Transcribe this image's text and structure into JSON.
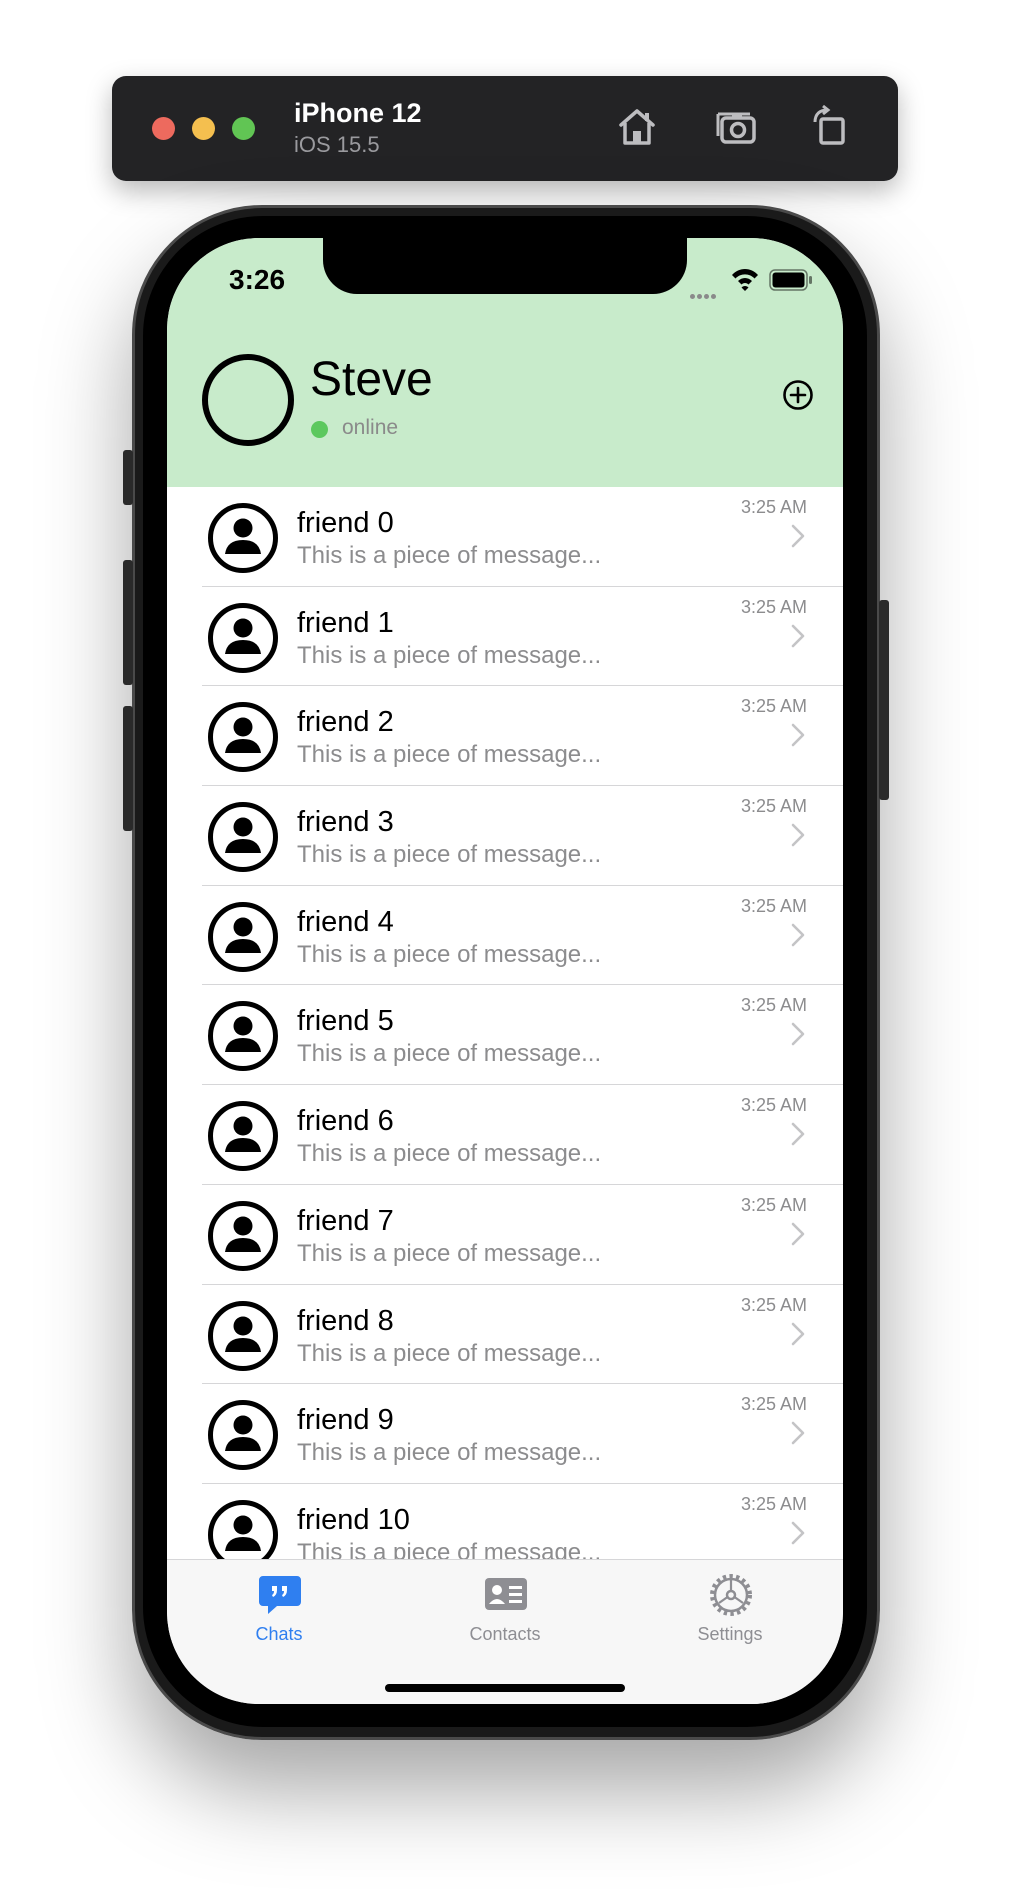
{
  "simulator": {
    "device": "iPhone 12",
    "os": "iOS 15.5",
    "icons": [
      "home-icon",
      "screenshot-icon",
      "rotate-icon"
    ]
  },
  "status_bar": {
    "time": "3:26"
  },
  "profile": {
    "name": "Steve",
    "status": "online",
    "status_color": "#5cc85e",
    "header_bg": "#c8ebcb"
  },
  "chats": [
    {
      "name": "friend 0",
      "message": "This is a piece of message...",
      "time": "3:25 AM"
    },
    {
      "name": "friend 1",
      "message": "This is a piece of message...",
      "time": "3:25 AM"
    },
    {
      "name": "friend 2",
      "message": "This is a piece of message...",
      "time": "3:25 AM"
    },
    {
      "name": "friend 3",
      "message": "This is a piece of message...",
      "time": "3:25 AM"
    },
    {
      "name": "friend 4",
      "message": "This is a piece of message...",
      "time": "3:25 AM"
    },
    {
      "name": "friend 5",
      "message": "This is a piece of message...",
      "time": "3:25 AM"
    },
    {
      "name": "friend 6",
      "message": "This is a piece of message...",
      "time": "3:25 AM"
    },
    {
      "name": "friend 7",
      "message": "This is a piece of message...",
      "time": "3:25 AM"
    },
    {
      "name": "friend 8",
      "message": "This is a piece of message...",
      "time": "3:25 AM"
    },
    {
      "name": "friend 9",
      "message": "This is a piece of message...",
      "time": "3:25 AM"
    },
    {
      "name": "friend 10",
      "message": "This is a piece of message...",
      "time": "3:25 AM"
    }
  ],
  "tab_bar": {
    "active_color": "#2f7ff0",
    "inactive_color": "#8e8e93",
    "tabs": [
      {
        "label": "Chats",
        "icon": "chat-bubble-icon",
        "active": true
      },
      {
        "label": "Contacts",
        "icon": "contact-card-icon",
        "active": false
      },
      {
        "label": "Settings",
        "icon": "gear-icon",
        "active": false
      }
    ]
  }
}
